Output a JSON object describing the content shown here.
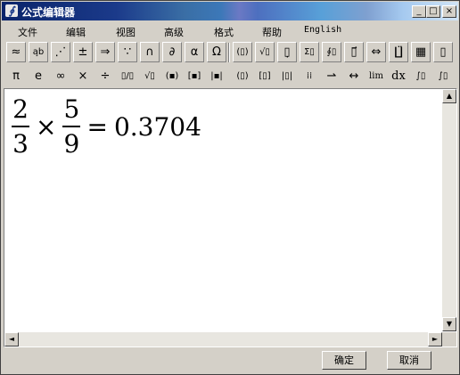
{
  "window": {
    "title": "公式编辑器",
    "app_icon": "∮"
  },
  "window_controls": {
    "minimize": "_",
    "maximize": "□",
    "close": "×"
  },
  "menu": [
    "文件",
    "编辑",
    "视图",
    "高级",
    "格式",
    "帮助",
    "English"
  ],
  "toolbar_row1": [
    {
      "icon": "approx-relations-icon",
      "glyph": "≈"
    },
    {
      "icon": "spaces-ellipses-icon",
      "glyph": "a̧b"
    },
    {
      "icon": "embellishments-icon",
      "glyph": "⋰"
    },
    {
      "icon": "operators-icon",
      "glyph": "±"
    },
    {
      "icon": "arrows-icon",
      "glyph": "⇒"
    },
    {
      "icon": "logic-icon",
      "glyph": "∵"
    },
    {
      "icon": "set-theory-icon",
      "glyph": "∩"
    },
    {
      "icon": "calculus-icon",
      "glyph": "∂"
    },
    {
      "icon": "greek-lower-icon",
      "glyph": "α"
    },
    {
      "icon": "greek-upper-icon",
      "glyph": "Ω"
    },
    {
      "icon": "fence-templates-icon",
      "glyph": "(▯)"
    },
    {
      "icon": "radical-templates-icon",
      "glyph": "√▯"
    },
    {
      "icon": "subscript-templates-icon",
      "glyph": "▯̣"
    },
    {
      "icon": "summation-templates-icon",
      "glyph": "Σ▯"
    },
    {
      "icon": "integral-templates-icon",
      "glyph": "∮▯"
    },
    {
      "icon": "underbar-templates-icon",
      "glyph": "▯⃗"
    },
    {
      "icon": "labeled-arrow-templates-icon",
      "glyph": "⇔"
    },
    {
      "icon": "products-templates-icon",
      "glyph": "∐̈"
    },
    {
      "icon": "matrix-templates-icon",
      "glyph": "▦"
    },
    {
      "icon": "box-templates-icon",
      "glyph": "▯"
    }
  ],
  "toolbar_row2": [
    {
      "icon": "pi-icon",
      "glyph": "π"
    },
    {
      "icon": "e-icon",
      "glyph": "e"
    },
    {
      "icon": "infinity-icon",
      "glyph": "∞"
    },
    {
      "icon": "times-icon",
      "glyph": "×"
    },
    {
      "icon": "divide-icon",
      "glyph": "÷"
    },
    {
      "icon": "fraction-icon",
      "glyph": "▯/▯"
    },
    {
      "icon": "sqrt-icon",
      "glyph": "√▯"
    },
    {
      "icon": "parentheses-icon",
      "glyph": "(▪)"
    },
    {
      "icon": "brackets-icon",
      "glyph": "[▪]"
    },
    {
      "icon": "abs-icon",
      "glyph": "|▪|"
    },
    {
      "icon": "paren-template-icon",
      "glyph": "(▯)"
    },
    {
      "icon": "bracket-template-icon",
      "glyph": "[▯]"
    },
    {
      "icon": "bar-template-icon",
      "glyph": "|▯|"
    },
    {
      "icon": "matrix-small-icon",
      "glyph": "⁞⁞"
    },
    {
      "icon": "right-arrow-icon",
      "glyph": "⇀"
    },
    {
      "icon": "left-right-arrow-icon",
      "glyph": "↔"
    },
    {
      "icon": "limit-icon",
      "glyph": "lim"
    },
    {
      "icon": "dx-icon",
      "glyph": "dx"
    },
    {
      "icon": "integral-box-icon",
      "glyph": "∫▯"
    },
    {
      "icon": "definite-integral-icon",
      "glyph": "∫▯"
    }
  ],
  "equation": {
    "frac1": {
      "num": "2",
      "den": "3"
    },
    "operator": "×",
    "frac2": {
      "num": "5",
      "den": "9"
    },
    "equals": "=",
    "result": "0.3704"
  },
  "scroll_arrows": {
    "up": "▲",
    "down": "▼",
    "left": "◄",
    "right": "►"
  },
  "buttons": {
    "ok": "确定",
    "cancel": "取消"
  }
}
